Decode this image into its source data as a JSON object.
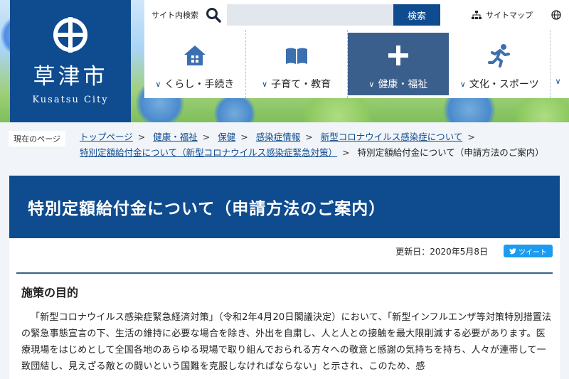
{
  "colors": {
    "brand": "#0f4b8f",
    "nav_active": "#3b5f8d",
    "tweet": "#1d9bf0"
  },
  "logo": {
    "name": "草津市",
    "english": "Kusatsu City"
  },
  "search": {
    "label": "サイト内検索",
    "placeholder": "",
    "button": "検索"
  },
  "utility": {
    "sitemap": "サイトマップ"
  },
  "nav": {
    "items": [
      {
        "label": "くらし・手続き",
        "icon": "house-icon"
      },
      {
        "label": "子育て・教育",
        "icon": "book-icon"
      },
      {
        "label": "健康・福祉",
        "icon": "plus-icon",
        "active": true
      },
      {
        "label": "文化・スポーツ",
        "icon": "runner-icon"
      }
    ]
  },
  "breadcrumb": {
    "tag": "現在のページ",
    "links": [
      "トップページ",
      "健康・福祉",
      "保健",
      "感染症情報",
      "新型コロナウイルス感染症について",
      "特別定額給付金について（新型コロナウイルス感染症緊急対策）"
    ],
    "current": "特別定額給付金について（申請方法のご案内）"
  },
  "page": {
    "title": "特別定額給付金について（申請方法のご案内）",
    "updated": "更新日：2020年5月8日",
    "tweet": "ツイート",
    "section_title": "施策の目的",
    "body": "「新型コロナウイルス感染症緊急経済対策」（令和2年4月20日閣議決定）において、「新型インフルエンザ等対策特別措置法の緊急事態宣言の下、生活の維持に必要な場合を除き、外出を自粛し、人と人との接触を最大限削減する必要があります。医療現場をはじめとして全国各地のあらゆる現場で取り組んでおられる方々への敬意と感謝の気持ちを持ち、人々が連帯して一致団結し、見えざる敵との闘いという国難を克服しなければならない」と示され、このため、感"
  }
}
